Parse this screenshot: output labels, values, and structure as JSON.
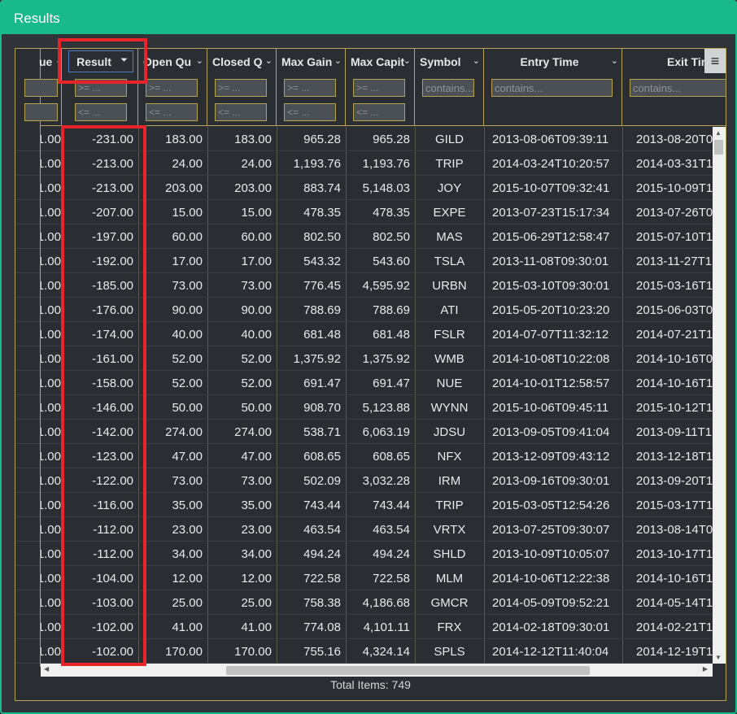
{
  "window": {
    "title": "Results"
  },
  "columns": {
    "value_partial": "ue",
    "result": "Result",
    "open_qty": "Open Qu",
    "closed_qty": "Closed Q",
    "max_gain": "Max Gain",
    "max_capital": "Max Capit",
    "symbol": "Symbol",
    "entry_time": "Entry Time",
    "exit_time": "Exit Time"
  },
  "filters": {
    "gte_placeholder": ">= ...",
    "lte_placeholder": "<= ...",
    "contains_placeholder": "contains..."
  },
  "rows": [
    [
      "1.00",
      "-231.00",
      "183.00",
      "183.00",
      "965.28",
      "965.28",
      "GILD",
      "2013-08-06T09:39:11",
      "2013-08-20T0"
    ],
    [
      "1.00",
      "-213.00",
      "24.00",
      "24.00",
      "1,193.76",
      "1,193.76",
      "TRIP",
      "2014-03-24T10:20:57",
      "2014-03-31T1"
    ],
    [
      "1.00",
      "-213.00",
      "203.00",
      "203.00",
      "883.74",
      "5,148.03",
      "JOY",
      "2015-10-07T09:32:41",
      "2015-10-09T1"
    ],
    [
      "1.00",
      "-207.00",
      "15.00",
      "15.00",
      "478.35",
      "478.35",
      "EXPE",
      "2013-07-23T15:17:34",
      "2013-07-26T0"
    ],
    [
      "1.00",
      "-197.00",
      "60.00",
      "60.00",
      "802.50",
      "802.50",
      "MAS",
      "2015-06-29T12:58:47",
      "2015-07-10T1"
    ],
    [
      "1.00",
      "-192.00",
      "17.00",
      "17.00",
      "543.32",
      "543.60",
      "TSLA",
      "2013-11-08T09:30:01",
      "2013-11-27T1"
    ],
    [
      "1.00",
      "-185.00",
      "73.00",
      "73.00",
      "776.45",
      "4,595.92",
      "URBN",
      "2015-03-10T09:30:01",
      "2015-03-16T1"
    ],
    [
      "1.00",
      "-176.00",
      "90.00",
      "90.00",
      "788.69",
      "788.69",
      "ATI",
      "2015-05-20T10:23:20",
      "2015-06-03T0"
    ],
    [
      "1.00",
      "-174.00",
      "40.00",
      "40.00",
      "681.48",
      "681.48",
      "FSLR",
      "2014-07-07T11:32:12",
      "2014-07-21T1"
    ],
    [
      "1.00",
      "-161.00",
      "52.00",
      "52.00",
      "1,375.92",
      "1,375.92",
      "WMB",
      "2014-10-08T10:22:08",
      "2014-10-16T0"
    ],
    [
      "1.00",
      "-158.00",
      "52.00",
      "52.00",
      "691.47",
      "691.47",
      "NUE",
      "2014-10-01T12:58:57",
      "2014-10-16T1"
    ],
    [
      "1.00",
      "-146.00",
      "50.00",
      "50.00",
      "908.70",
      "5,123.88",
      "WYNN",
      "2015-10-06T09:45:11",
      "2015-10-12T1"
    ],
    [
      "1.00",
      "-142.00",
      "274.00",
      "274.00",
      "538.71",
      "6,063.19",
      "JDSU",
      "2013-09-05T09:41:04",
      "2013-09-11T1"
    ],
    [
      "1.00",
      "-123.00",
      "47.00",
      "47.00",
      "608.65",
      "608.65",
      "NFX",
      "2013-12-09T09:43:12",
      "2013-12-18T1"
    ],
    [
      "1.00",
      "-122.00",
      "73.00",
      "73.00",
      "502.09",
      "3,032.28",
      "IRM",
      "2013-09-16T09:30:01",
      "2013-09-20T1"
    ],
    [
      "1.00",
      "-116.00",
      "35.00",
      "35.00",
      "743.44",
      "743.44",
      "TRIP",
      "2015-03-05T12:54:26",
      "2015-03-17T1"
    ],
    [
      "1.00",
      "-112.00",
      "23.00",
      "23.00",
      "463.54",
      "463.54",
      "VRTX",
      "2013-07-25T09:30:07",
      "2013-08-14T0"
    ],
    [
      "1.00",
      "-112.00",
      "34.00",
      "34.00",
      "494.24",
      "494.24",
      "SHLD",
      "2013-10-09T10:05:07",
      "2013-10-17T1"
    ],
    [
      "1.00",
      "-104.00",
      "12.00",
      "12.00",
      "722.58",
      "722.58",
      "MLM",
      "2014-10-06T12:22:38",
      "2014-10-16T1"
    ],
    [
      "1.00",
      "-103.00",
      "25.00",
      "25.00",
      "758.38",
      "4,186.68",
      "GMCR",
      "2014-05-09T09:52:21",
      "2014-05-14T1"
    ],
    [
      "1.00",
      "-102.00",
      "41.00",
      "41.00",
      "774.08",
      "4,101.11",
      "FRX",
      "2014-02-18T09:30:01",
      "2014-02-21T1"
    ],
    [
      "1.00",
      "-102.00",
      "170.00",
      "170.00",
      "755.16",
      "4,324.14",
      "SPLS",
      "2014-12-12T11:40:04",
      "2014-12-19T1"
    ]
  ],
  "footer": {
    "total_items": "Total Items: 749"
  },
  "colors": {
    "accent": "#18b98a",
    "highlight": "#e8232a",
    "filter_border": "#b5a14e"
  },
  "icons": {
    "menu": "hamburger-menu-icon",
    "chevron": "chevron-down-icon",
    "sort": "sort-descending-icon"
  }
}
